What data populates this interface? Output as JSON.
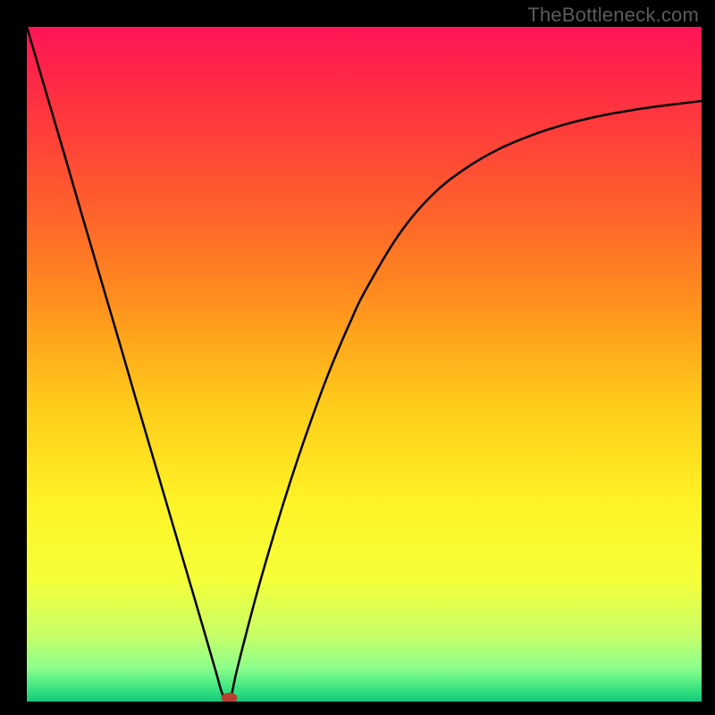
{
  "watermark": "TheBottleneck.com",
  "chart_data": {
    "type": "line",
    "title": "",
    "xlabel": "",
    "ylabel": "",
    "xlim": [
      0,
      100
    ],
    "ylim": [
      0,
      100
    ],
    "series": [
      {
        "name": "curve",
        "x": [
          0,
          2,
          4,
          6,
          8,
          10,
          12,
          14,
          16,
          18,
          20,
          22,
          24,
          26,
          28,
          29,
          30,
          31,
          32,
          34,
          36,
          38,
          40,
          42,
          44,
          46,
          48,
          50,
          55,
          60,
          65,
          70,
          75,
          80,
          85,
          90,
          95,
          100
        ],
        "y": [
          100,
          93.2,
          86.4,
          79.6,
          72.7,
          65.9,
          59.1,
          52.3,
          45.4,
          38.6,
          31.8,
          25.0,
          18.2,
          11.4,
          4.5,
          1.1,
          0.0,
          4.1,
          8.1,
          15.7,
          22.7,
          29.3,
          35.5,
          41.3,
          46.8,
          51.8,
          56.4,
          60.6,
          69.0,
          75.0,
          79.0,
          81.9,
          84.0,
          85.6,
          86.8,
          87.7,
          88.4,
          89.0
        ]
      }
    ],
    "marker": {
      "x": 30,
      "y": 0
    },
    "background_gradient": {
      "stops": [
        {
          "at": 0.0,
          "color": "#ff1456"
        },
        {
          "at": 0.1,
          "color": "#ff2e42"
        },
        {
          "at": 0.25,
          "color": "#ff5a2e"
        },
        {
          "at": 0.4,
          "color": "#ff8d1e"
        },
        {
          "at": 0.55,
          "color": "#ffc81a"
        },
        {
          "at": 0.7,
          "color": "#fff225"
        },
        {
          "at": 0.82,
          "color": "#f4ff3a"
        },
        {
          "at": 0.9,
          "color": "#c8ff66"
        },
        {
          "at": 0.95,
          "color": "#8cff8c"
        },
        {
          "at": 0.985,
          "color": "#30e080"
        },
        {
          "at": 1.0,
          "color": "#18c47a"
        }
      ]
    }
  }
}
